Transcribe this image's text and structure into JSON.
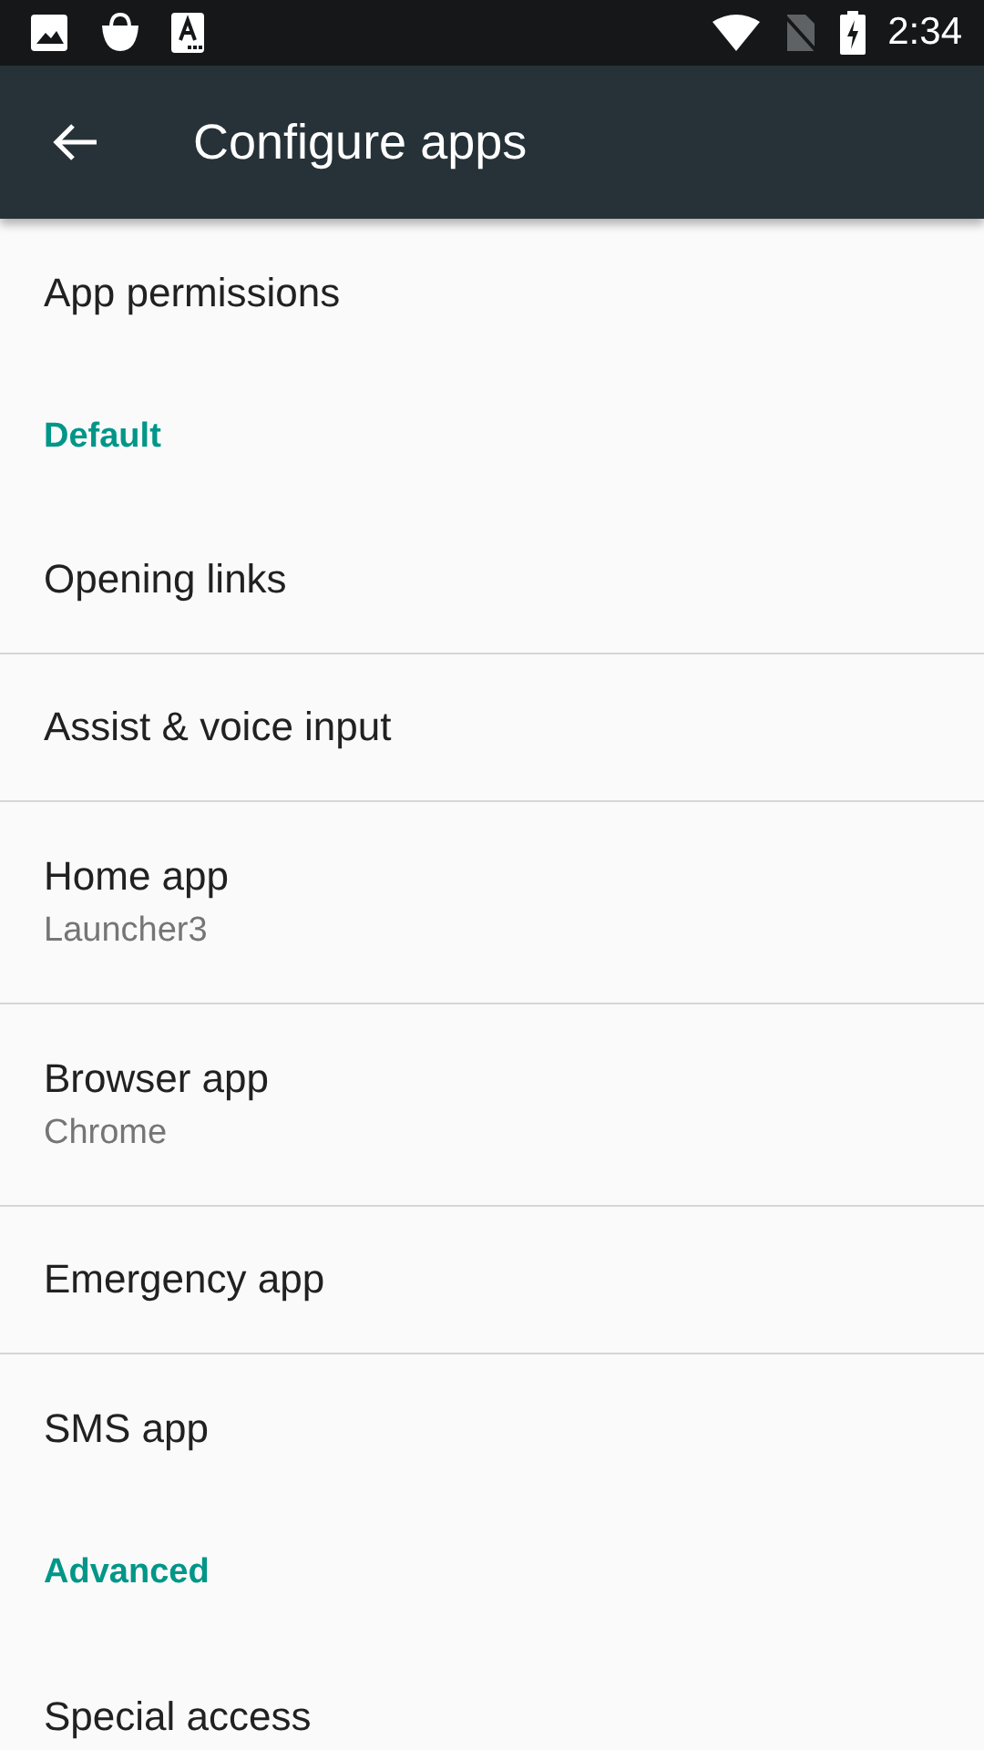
{
  "status_bar": {
    "time": "2:34"
  },
  "toolbar": {
    "title": "Configure apps"
  },
  "items": [
    {
      "kind": "item",
      "title": "App permissions",
      "divider": false
    },
    {
      "kind": "header",
      "title": "Default"
    },
    {
      "kind": "item",
      "title": "Opening links",
      "divider": true
    },
    {
      "kind": "item",
      "title": "Assist & voice input",
      "divider": true
    },
    {
      "kind": "item",
      "title": "Home app",
      "summary": "Launcher3",
      "divider": true
    },
    {
      "kind": "item",
      "title": "Browser app",
      "summary": "Chrome",
      "divider": true
    },
    {
      "kind": "item",
      "title": "Emergency app",
      "divider": true
    },
    {
      "kind": "item",
      "title": "SMS app",
      "divider": false
    },
    {
      "kind": "header",
      "title": "Advanced"
    },
    {
      "kind": "item",
      "title": "Special access",
      "divider": false
    }
  ]
}
